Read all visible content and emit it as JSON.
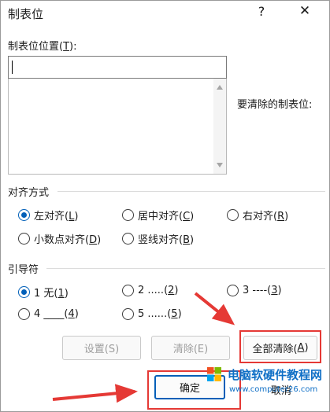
{
  "window": {
    "title": "制表位",
    "help_glyph": "?",
    "close_glyph": "✕"
  },
  "tab_position": {
    "label_prefix": "制表位位置(",
    "label_hotkey": "T",
    "label_suffix": "):",
    "value": ""
  },
  "clear_label": "要清除的制表位:",
  "alignment": {
    "title": "对齐方式",
    "options": [
      {
        "prefix": "左对齐(",
        "hotkey": "L",
        "suffix": ")",
        "selected": true
      },
      {
        "prefix": "居中对齐(",
        "hotkey": "C",
        "suffix": ")",
        "selected": false
      },
      {
        "prefix": "右对齐(",
        "hotkey": "R",
        "suffix": ")",
        "selected": false
      },
      {
        "prefix": "小数点对齐(",
        "hotkey": "D",
        "suffix": ")",
        "selected": false
      },
      {
        "prefix": "竖线对齐(",
        "hotkey": "B",
        "suffix": ")",
        "selected": false
      }
    ]
  },
  "leader": {
    "title": "引导符",
    "options": [
      {
        "prefix": "1 无(",
        "hotkey": "1",
        "suffix": ")",
        "selected": true
      },
      {
        "prefix": "2 .....(",
        "hotkey": "2",
        "suffix": ")",
        "selected": false
      },
      {
        "prefix": "3 ----(",
        "hotkey": "3",
        "suffix": ")",
        "selected": false
      },
      {
        "prefix": "4 ____(",
        "hotkey": "4",
        "suffix": ")",
        "selected": false
      },
      {
        "prefix": "5 ......(",
        "hotkey": "5",
        "suffix": ")",
        "selected": false
      }
    ]
  },
  "buttons": {
    "set": "设置(S)",
    "clear": "清除(E)",
    "clear_all_prefix": "全部清除(",
    "clear_all_hotkey": "A",
    "clear_all_suffix": ")",
    "ok": "确定",
    "cancel": "取消"
  },
  "watermark": {
    "cn": "电脑软硬件教程网",
    "en": "www.computer26.com"
  },
  "colors": {
    "accent": "#005fb8",
    "highlight": "#e53935"
  }
}
